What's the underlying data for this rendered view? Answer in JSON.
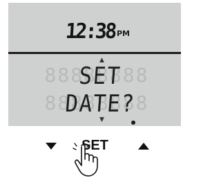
{
  "display": {
    "time": "12:38",
    "period": "PM",
    "message_line1": "SET",
    "message_line2": "DATE?",
    "ghost_glyph": "8",
    "background_color": "#cfd1d1",
    "segment_color": "#1e1e1e",
    "ghost_color": "#b8baba"
  },
  "controls": {
    "down_icon": "triangle-down-icon",
    "set_label": "SET",
    "up_icon": "triangle-up-icon",
    "pointer_icon": "hand-pointer-icon"
  }
}
